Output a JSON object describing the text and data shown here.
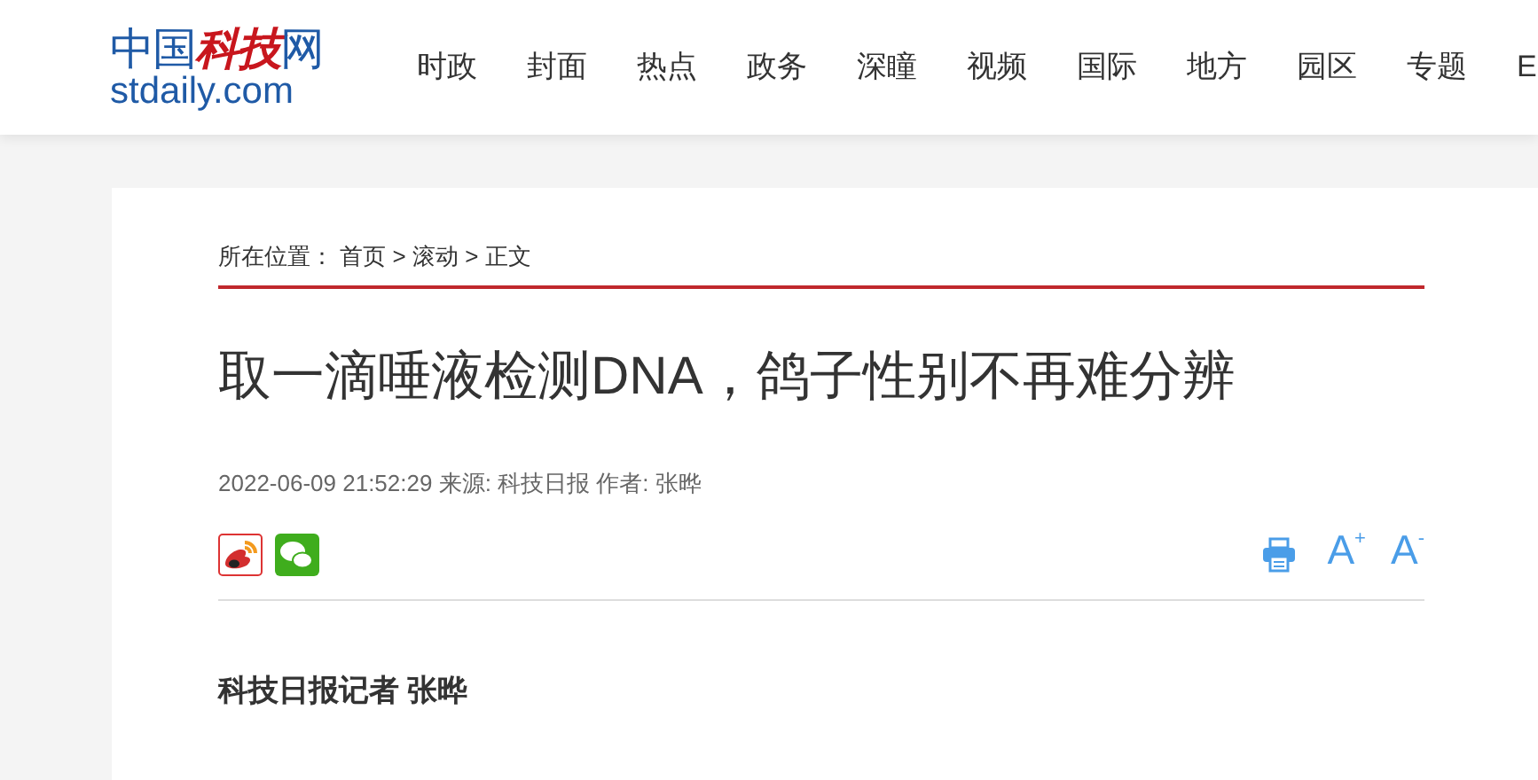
{
  "logo": {
    "title_parts": [
      {
        "text": "中国",
        "accent": false
      },
      {
        "text": "科技",
        "accent": true
      },
      {
        "text": "网",
        "accent": false
      }
    ],
    "domain": "stdaily.com"
  },
  "nav": [
    "时政",
    "封面",
    "热点",
    "政务",
    "深瞳",
    "视频",
    "国际",
    "地方",
    "园区",
    "专题",
    "E"
  ],
  "breadcrumb": {
    "label": "所在位置：",
    "items": [
      "首页",
      "滚动",
      "正文"
    ],
    "separator": ">"
  },
  "article": {
    "title": "取一滴唾液检测DNA，鸽子性别不再难分辨",
    "meta": "2022-06-09 21:52:29 来源: 科技日报 作者: 张晔",
    "font_buttons": [
      "A$^{+}$",
      "A$^{-}$"
    ],
    "byline": "科技日报记者 张晔"
  }
}
